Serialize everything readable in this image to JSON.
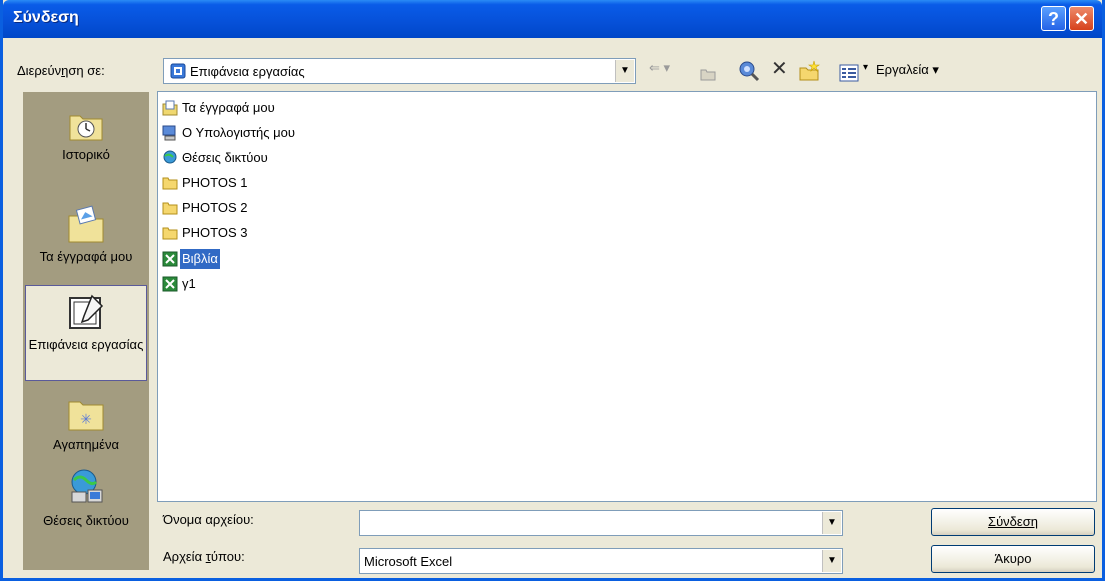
{
  "window": {
    "title": "Σύνδεση",
    "help_glyph": "?",
    "close_glyph": "✕"
  },
  "lookin": {
    "label_pre": "Διερεύν",
    "label_accel": "η",
    "label_post": "ση σε:",
    "value": "Επιφάνεια εργασίας",
    "icon": "desktop-icon"
  },
  "toolbar": {
    "back_glyph": "⇐ ▾",
    "delete_glyph": "✕",
    "views_arrow": "▾",
    "tools_label": "Εργαλεία ▾"
  },
  "places": [
    {
      "label": "Ιστορικό",
      "icon": "history-icon",
      "selected": false
    },
    {
      "label": "Τα έγγραφά μου",
      "icon": "my-documents-icon",
      "selected": false
    },
    {
      "label": "Επιφάνεια εργασίας",
      "icon": "desktop-icon",
      "selected": true
    },
    {
      "label": "Αγαπημένα",
      "icon": "favorites-icon",
      "selected": false
    },
    {
      "label": "Θέσεις δικτύου",
      "icon": "network-places-icon",
      "selected": false
    }
  ],
  "files": [
    {
      "name": "Τα έγγραφά μου",
      "icon": "my-documents-icon",
      "selected": false
    },
    {
      "name": "Ο Υπολογιστής μου",
      "icon": "my-computer-icon",
      "selected": false
    },
    {
      "name": "Θέσεις δικτύου",
      "icon": "network-places-icon",
      "selected": false
    },
    {
      "name": "PHOTOS 1",
      "icon": "folder-icon",
      "selected": false
    },
    {
      "name": "PHOTOS 2",
      "icon": "folder-icon",
      "selected": false
    },
    {
      "name": "PHOTOS 3",
      "icon": "folder-icon",
      "selected": false
    },
    {
      "name": "Βιβλία",
      "icon": "excel-file-icon",
      "selected": true
    },
    {
      "name": "γ1",
      "icon": "excel-file-icon",
      "selected": false
    }
  ],
  "filename": {
    "label_pre": "Όνομα αρ",
    "label_accel": "χ",
    "label_post": "είου:",
    "value": ""
  },
  "filetype": {
    "label_pre": "Αρχεία ",
    "label_accel": "τ",
    "label_post": "ύπου:",
    "value": "Microsoft Excel"
  },
  "buttons": {
    "ok_label": "Σύνδεση",
    "cancel_label": "Άκυρο"
  },
  "colors": {
    "titlebar": "#0a5ce8",
    "places_bar": "#a39c80",
    "selection": "#316ac5",
    "dialog_bg": "#ece9d8"
  }
}
